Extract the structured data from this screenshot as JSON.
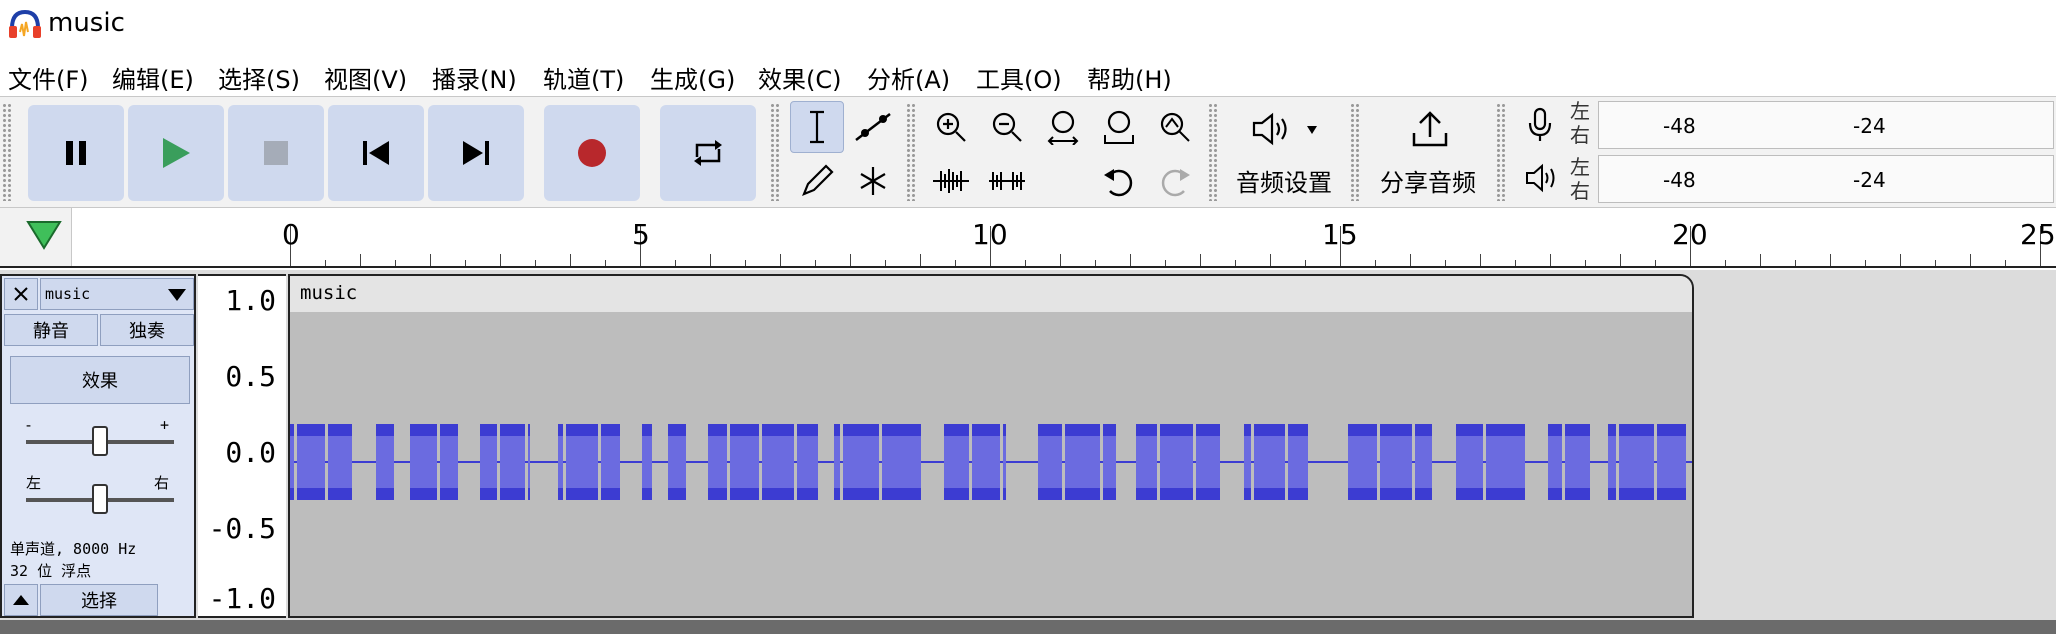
{
  "window": {
    "title": "music"
  },
  "menu": [
    "文件(F)",
    "编辑(E)",
    "选择(S)",
    "视图(V)",
    "播录(N)",
    "轨道(T)",
    "生成(G)",
    "效果(C)",
    "分析(A)",
    "工具(O)",
    "帮助(H)"
  ],
  "toolbar": {
    "transport": [
      "pause-icon",
      "play-icon",
      "stop-icon",
      "skip-start-icon",
      "skip-end-icon",
      "record-icon",
      "loop-icon"
    ],
    "audio_settings_label": "音频设置",
    "share_audio_label": "分享音频",
    "meters": {
      "record": {
        "left": "左",
        "right": "右",
        "ticks": [
          "-48",
          "-24"
        ]
      },
      "playback": {
        "left": "左",
        "right": "右",
        "ticks": [
          "-48",
          "-24"
        ]
      }
    }
  },
  "ruler": {
    "labels": [
      "0",
      "5",
      "10",
      "15",
      "20",
      "25"
    ]
  },
  "track": {
    "name": "music",
    "mute_label": "静音",
    "solo_label": "独奏",
    "effects_label": "效果",
    "gain_minus": "-",
    "gain_plus": "+",
    "pan_left": "左",
    "pan_right": "右",
    "info_line1": "单声道, 8000 Hz",
    "info_line2": "32 位 浮点",
    "select_label": "选择",
    "scale_labels": [
      "1.0",
      "0.5",
      "0.0",
      "-0.5",
      "-1.0"
    ],
    "clip_name": "music"
  },
  "colors": {
    "waveform": "#3c3cd2",
    "waveform_rms": "#6b6be0",
    "button_bg": "#cfd9ee",
    "record": "#b8282c",
    "play": "#3a9e5c"
  }
}
